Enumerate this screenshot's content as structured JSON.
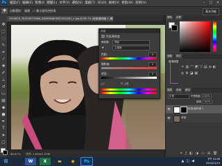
{
  "app": {
    "logo": "Ps"
  },
  "menubar": {
    "items": [
      "檔案(F)",
      "編輯(E)",
      "影像(I)",
      "圖層(L)",
      "文字(Y)",
      "選取(S)",
      "濾鏡(T)",
      "3D(D)",
      "檢視(V)",
      "視窗(W)",
      "說明(H)"
    ],
    "window_controls": [
      "–",
      "□",
      "✕"
    ]
  },
  "optionsbar": {
    "tool_icon": "move-tool",
    "options": [
      "自動選取:",
      "圖層",
      "☐ 顯示變形控制項"
    ],
    "workspace": "基本功能"
  },
  "document": {
    "tab_title": "1929874_767016719984_3605964605522010431_n.jpg @ 66.7% (色相/飽和度 1, 圖層遮色片/8) *",
    "close": "×"
  },
  "properties": {
    "header": "內容",
    "title": "色相/飽和度",
    "preset_label": "預設集:",
    "preset_value": "預設",
    "channel_value": "主檔案",
    "hue_label": "色相:",
    "hue_value": "0",
    "sat_label": "飽和度:",
    "sat_value": "0",
    "light_label": "明亮:",
    "light_value": "0",
    "colorize_label": "上色"
  },
  "right_panels": {
    "color_tabs": [
      "顏色",
      "色票"
    ],
    "adjust_tabs": [
      "調整",
      "樣式"
    ],
    "adjust_title": "新增調整",
    "layers_tabs": [
      "圖層",
      "色版",
      "路徑"
    ],
    "blend_mode": "正常",
    "opacity_label": "不透明度:",
    "opacity_value": "100%",
    "fill_label": "填滿:",
    "fill_value": "100%",
    "layers": [
      {
        "name": "色相/飽和度 1"
      },
      {
        "name": "背景"
      }
    ]
  },
  "statusbar": {
    "zoom": "66.67%",
    "doc": "文件: 1.65M/3.29M"
  },
  "taskbar": {
    "apps": [
      "word-icon",
      "excel-icon",
      "chrome-icon",
      "folder-icon",
      "photoshop-icon"
    ],
    "time": "下午 01:06",
    "date": "2014/11/13"
  },
  "colors": {
    "accent": "#31a8ff",
    "dock": "#383838",
    "taskbar": "#1d2b3e"
  }
}
